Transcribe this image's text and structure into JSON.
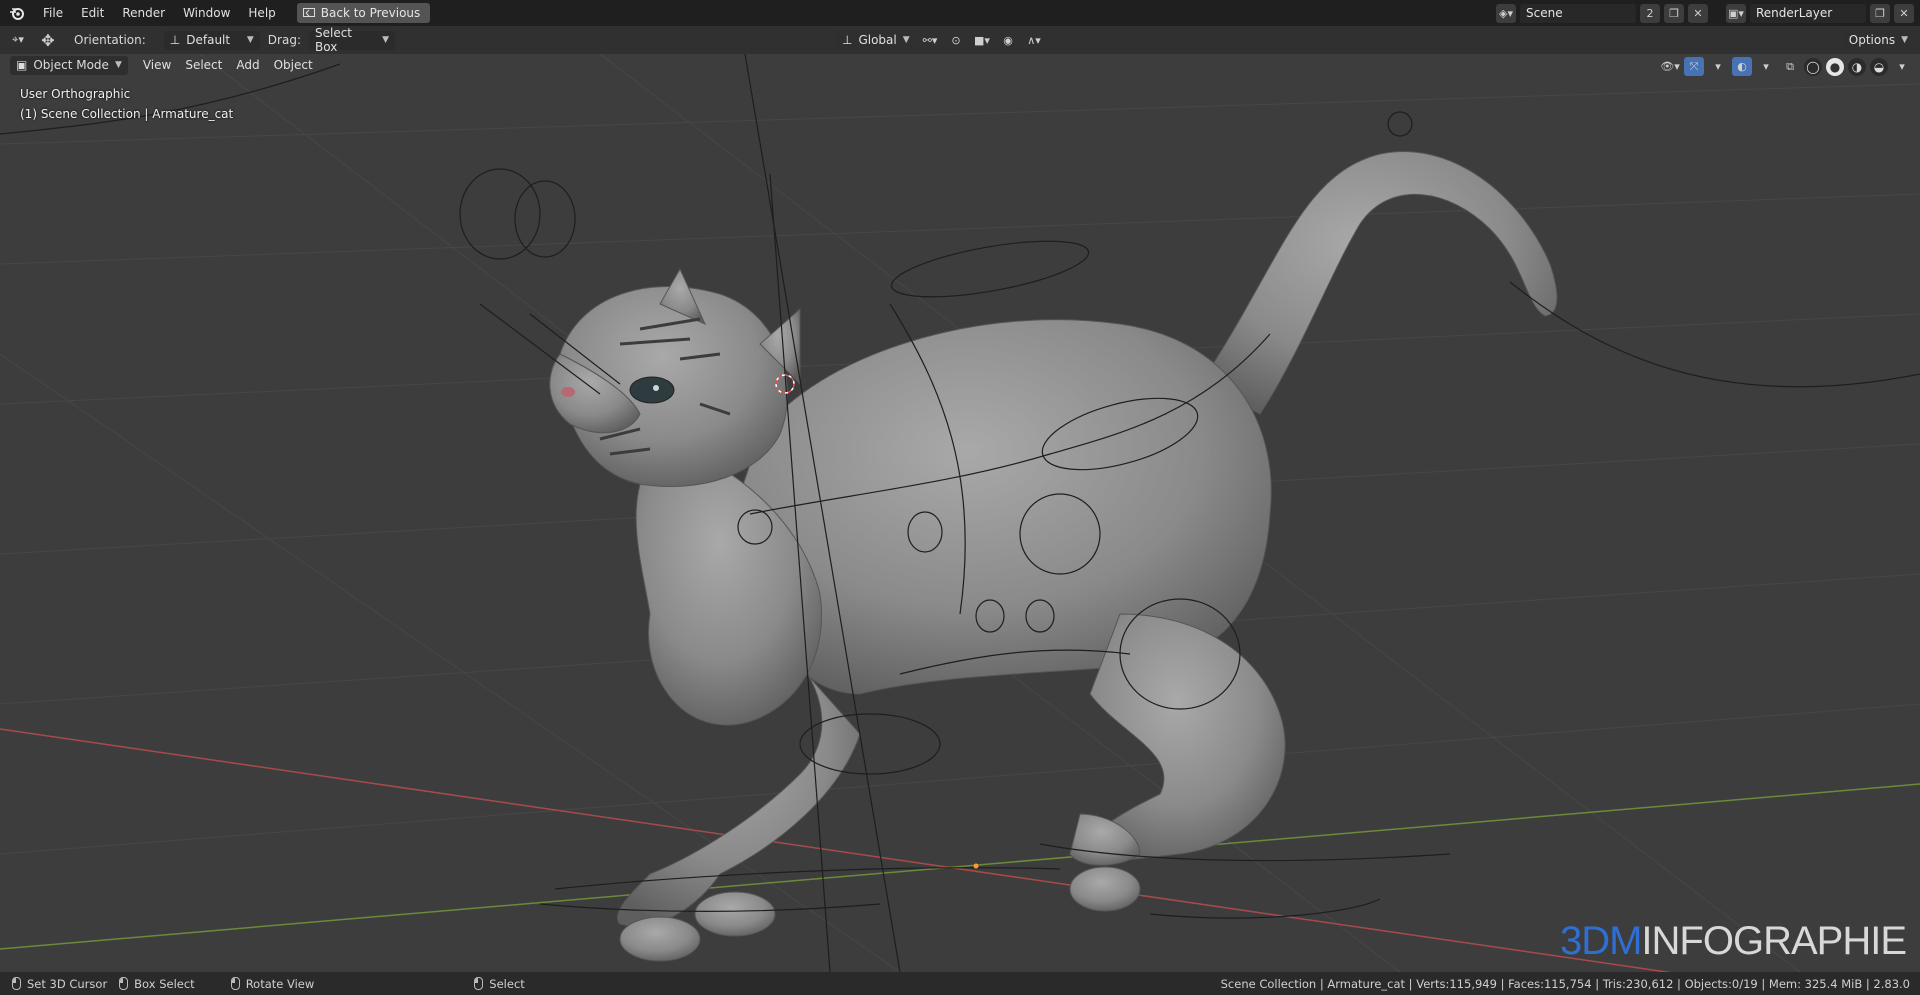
{
  "menubar": {
    "items": [
      "File",
      "Edit",
      "Render",
      "Window",
      "Help"
    ],
    "back_button": "Back to Previous",
    "scene_name": "Scene",
    "scene_users": "2",
    "render_layer": "RenderLayer"
  },
  "toolheader": {
    "orientation_label": "Orientation:",
    "orientation_value": "Default",
    "drag_label": "Drag:",
    "drag_value": "Select Box",
    "transform_orientation": "Global",
    "options_label": "Options"
  },
  "viewheader": {
    "mode": "Object Mode",
    "menus": [
      "View",
      "Select",
      "Add",
      "Object"
    ]
  },
  "viewport": {
    "view_name": "User Orthographic",
    "collection_info": "(1) Scene Collection | Armature_cat",
    "watermark_a": "3DM",
    "watermark_b": "INFOGRAPHIE"
  },
  "statusbar": {
    "left_items": [
      "Set 3D Cursor",
      "Box Select",
      "Rotate View",
      "Select"
    ],
    "stats": "Scene Collection | Armature_cat | Verts:115,949 | Faces:115,754 | Tris:230,612 | Objects:0/19 | Mem: 325.4 MiB | 2.83.0"
  },
  "colors": {
    "accent": "#4772b3",
    "x_axis": "#a84a4a",
    "y_axis": "#6b8a3a",
    "watermark_blue": "#2f6fd4"
  }
}
